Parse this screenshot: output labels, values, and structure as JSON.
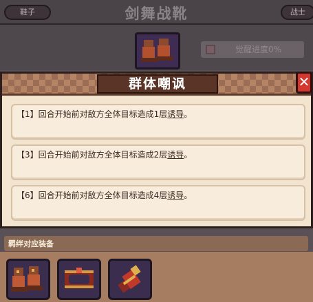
{
  "background": {
    "title": "剑舞战靴",
    "left_tag": "鞋子",
    "right_tag": "战士",
    "awaken_label": "觉醒进度0%"
  },
  "modal": {
    "title": "群体嘲讽",
    "close_symbol": "✕",
    "effects": [
      {
        "prefix": "【1】回合开始前对敌方全体目标造成1层",
        "keyword": "诱导",
        "suffix": "。"
      },
      {
        "prefix": "【3】回合开始前对敌方全体目标造成2层",
        "keyword": "诱导",
        "suffix": "。"
      },
      {
        "prefix": "【6】回合开始前对敌方全体目标造成4层",
        "keyword": "诱导",
        "suffix": "。"
      }
    ]
  },
  "bond": {
    "title": "羁绊对应装备",
    "items": [
      "boots-icon",
      "crown-icon",
      "glove-icon"
    ]
  }
}
